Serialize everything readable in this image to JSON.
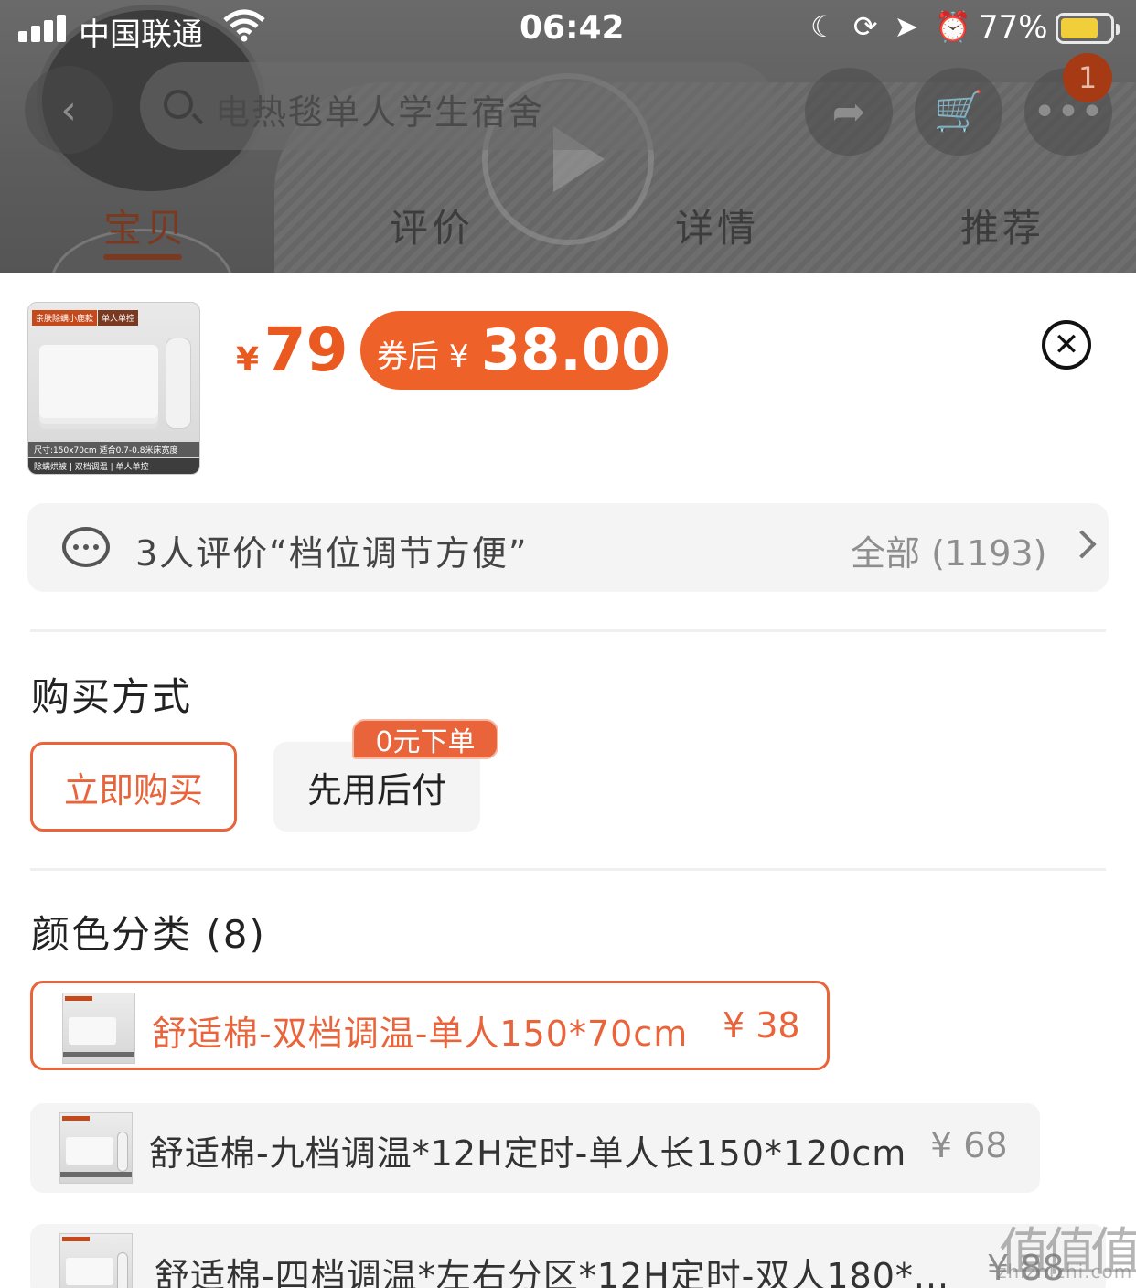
{
  "status_bar": {
    "carrier": "中国联通",
    "time": "06:42",
    "battery_percent": "77%",
    "battery_level": 0.77
  },
  "top_nav": {
    "search_text": "电热毯单人学生宿舍",
    "cart_badge": "1",
    "tabs": [
      "宝贝",
      "评价",
      "详情",
      "推荐"
    ],
    "active_tab": 0
  },
  "product": {
    "original_price_symbol": "¥",
    "original_price": "79",
    "coupon_label": "券后",
    "coupon_price_symbol": "¥",
    "coupon_price": "38.00",
    "thumb_tag_left": "亲肤除螨小鹿款",
    "thumb_tag_right": "单人单控",
    "thumb_size": "尺寸:150x70cm 适合0.7-0.8米床宽度",
    "thumb_features": "除螨烘被 | 双档调温 | 单人单控"
  },
  "review_summary": {
    "text": "3人评价“档位调节方便”",
    "all_label": "全部 (1193)"
  },
  "purchase_method": {
    "title": "购买方式",
    "options": [
      "立即购买",
      "先用后付"
    ],
    "badge": "0元下单"
  },
  "color_category": {
    "title": "颜色分类 (8)",
    "variants": [
      {
        "name": "舒适棉-双档调温-单人150*70cm",
        "price": "¥ 38"
      },
      {
        "name": "舒适棉-九档调温*12H定时-单人长150*120cm",
        "price": "¥ 68"
      },
      {
        "name": "舒适棉-四档调温*左右分区*12H定时-双人180*...",
        "price": "¥ 88"
      }
    ]
  },
  "watermark": {
    "mark": "值值值",
    "site": "zhizhizhi.com"
  },
  "colors": {
    "accent": "#ee6128",
    "accent_border": "#e9643a",
    "grey_bg": "#f4f4f4"
  }
}
